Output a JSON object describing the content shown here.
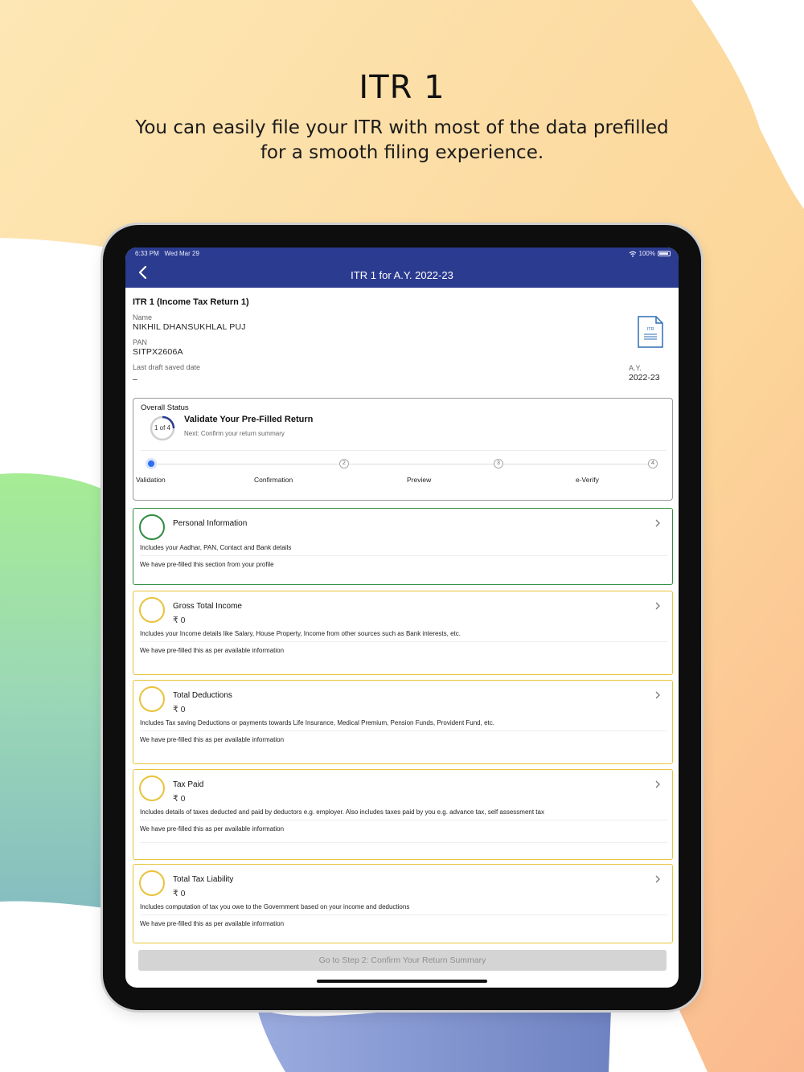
{
  "promo": {
    "title": "ITR 1",
    "subtitle": "You can easily file your ITR with most of the data prefilled for a smooth filing experience."
  },
  "status_bar": {
    "time": "6:33 PM",
    "date": "Wed Mar 29",
    "battery": "100%"
  },
  "nav": {
    "title": "ITR 1 for A.Y. 2022-23",
    "back_icon": "chevron-left-icon"
  },
  "summary": {
    "heading": "ITR 1 (Income Tax Return 1)",
    "name_label": "Name",
    "name_value": "NIKHIL DHANSUKHLAL PUJ",
    "pan_label": "PAN",
    "pan_value": "SITPX2606A",
    "draft_label": "Last draft saved date",
    "draft_value": "–",
    "doc_icon_text": "ITR",
    "ay_label": "A.Y.",
    "ay_value": "2022-23"
  },
  "overall_status": {
    "label": "Overall Status",
    "progress_text": "1 of 4",
    "progress_fraction": 0.25,
    "title": "Validate Your Pre-Filled Return",
    "next": "Next: Confirm your return summary",
    "steps": [
      {
        "label": "Validation",
        "number": ""
      },
      {
        "label": "Confirmation",
        "number": "2"
      },
      {
        "label": "Preview",
        "number": "3"
      },
      {
        "label": "e-Verify",
        "number": "4"
      }
    ]
  },
  "sections": [
    {
      "title": "Personal Information",
      "amount": "",
      "description": "Includes your Aadhar, PAN, Contact and Bank details",
      "note": "We have pre-filled this section from your profile"
    },
    {
      "title": "Gross Total Income",
      "amount": "₹ 0",
      "description": "Includes your Income details like Salary, House Property, Income from other sources such as Bank interests, etc.",
      "note": "We have pre-filled this as per available information"
    },
    {
      "title": "Total Deductions",
      "amount": "₹ 0",
      "description": "Includes Tax saving Deductions or payments towards Life Insurance, Medical Premium, Pension Funds, Provident Fund, etc.",
      "note": "We have pre-filled this as per available information"
    },
    {
      "title": "Tax Paid",
      "amount": "₹ 0",
      "description": "Includes details of taxes deducted and paid by deductors e.g. employer. Also includes taxes paid by you e.g. advance tax, self assessment tax",
      "note": "We have pre-filled this as per available information"
    },
    {
      "title": "Total Tax Liability",
      "amount": "₹ 0",
      "description": "Includes computation of tax you owe to the Government based on your income and deductions",
      "note": "We have pre-filled this as per available information"
    }
  ],
  "footer": {
    "button_label": "Go to Step 2: Confirm Your Return Summary"
  },
  "colors": {
    "nav_bar": "#2b3b8f",
    "complete_border": "#2e8b3f",
    "pending_border": "#e8c33a",
    "progress_arc": "#2b3b8f",
    "active_step": "#2f6df0",
    "disabled_button": "#d4d4d4"
  }
}
